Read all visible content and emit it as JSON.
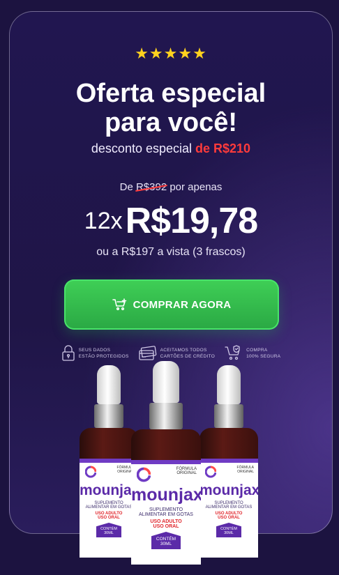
{
  "rating": {
    "stars": "★★★★★",
    "star_color": "#ffd21e"
  },
  "header": {
    "title_line1": "Oferta especial",
    "title_line2": "para você!",
    "subtitle_prefix": "desconto especial ",
    "subtitle_highlight": "de R$210"
  },
  "pricing": {
    "from_prefix": "De ",
    "old_price": "R$392",
    "from_suffix": " por apenas",
    "installments": "12x",
    "installment_price": "R$19,78",
    "cash_offer": "ou a R$197 a vista (3 frascos)"
  },
  "cta": {
    "label": "COMPRAR AGORA",
    "color": "#3fcf56"
  },
  "trust_badges": [
    {
      "icon": "lock-icon",
      "line1": "SEUS DADOS",
      "line2": "ESTÃO PROTEGIDOS"
    },
    {
      "icon": "credit-card-icon",
      "line1": "ACEITAMOS TODOS",
      "line2": "CARTÕES DE CRÉDITO"
    },
    {
      "icon": "secure-cart-icon",
      "line1": "COMPRA",
      "line2": "100% SEGURA"
    }
  ],
  "product": {
    "brand": "mounjax",
    "formula_line1": "FÓRMULA",
    "formula_line2": "ORIGINAL",
    "desc_line1": "SUPLEMENTO",
    "desc_line2": "ALIMENTAR EM GOTAS",
    "use_line1": "USO ADULTO",
    "use_line2": "USO ORAL",
    "content_line1": "CONTÉM",
    "content_line2": "30ml"
  },
  "colors": {
    "background": "#1f1547",
    "accent_red": "#ff3b3b",
    "brand_purple": "#5b2aa8"
  }
}
